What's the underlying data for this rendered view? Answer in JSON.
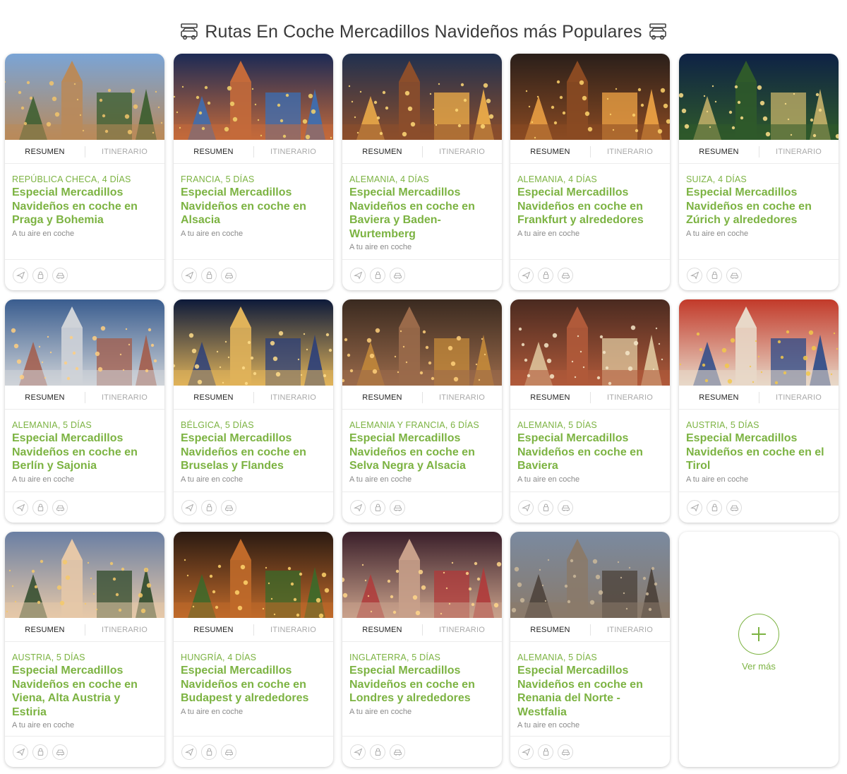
{
  "header": {
    "title": "Rutas En Coche Mercadillos Navideños más Populares"
  },
  "tabs": {
    "summary": "RESUMEN",
    "itinerary": "ITINERARIO"
  },
  "colors": {
    "accent": "#7cb342",
    "muted": "#8a8a8a"
  },
  "footer_icons": [
    "plane-icon",
    "lock-icon",
    "car-icon"
  ],
  "cards": [
    {
      "meta": "REPÚBLICA CHECA, 4 DÍAS",
      "title": "Especial Mercadillos Navideños en coche en Praga y Bohemia",
      "subtitle": "A tu aire en coche"
    },
    {
      "meta": "FRANCIA, 5 DÍAS",
      "title": "Especial Mercadillos Navideños en coche en Alsacia",
      "subtitle": "A tu aire en coche"
    },
    {
      "meta": "ALEMANIA, 4 DÍAS",
      "title": "Especial Mercadillos Navideños en coche en Baviera y Baden-Wurtemberg",
      "subtitle": "A tu aire en coche"
    },
    {
      "meta": "ALEMANIA, 4 DÍAS",
      "title": "Especial Mercadillos Navideños en coche en Frankfurt y alrededores",
      "subtitle": "A tu aire en coche"
    },
    {
      "meta": "SUIZA, 4 DÍAS",
      "title": "Especial Mercadillos Navideños en coche en Zúrich y alrededores",
      "subtitle": "A tu aire en coche"
    },
    {
      "meta": "ALEMANIA, 5 DÍAS",
      "title": "Especial Mercadillos Navideños en coche en Berlín y Sajonia",
      "subtitle": "A tu aire en coche"
    },
    {
      "meta": "BÉLGICA, 5 DÍAS",
      "title": "Especial Mercadillos Navideños en coche en Bruselas y Flandes",
      "subtitle": "A tu aire en coche"
    },
    {
      "meta": "ALEMANIA Y FRANCIA, 6 DÍAS",
      "title": "Especial Mercadillos Navideños en coche en Selva Negra y Alsacia",
      "subtitle": "A tu aire en coche"
    },
    {
      "meta": "ALEMANIA, 5 DÍAS",
      "title": "Especial Mercadillos Navideños en coche en Baviera",
      "subtitle": "A tu aire en coche"
    },
    {
      "meta": "AUSTRIA, 5 DÍAS",
      "title": "Especial Mercadillos Navideños en coche en el Tirol",
      "subtitle": "A tu aire en coche"
    },
    {
      "meta": "AUSTRIA, 5 DÍAS",
      "title": "Especial Mercadillos Navideños en coche en Viena, Alta Austria y Estiria",
      "subtitle": "A tu aire en coche"
    },
    {
      "meta": "HUNGRÍA, 4 DÍAS",
      "title": "Especial Mercadillos Navideños en coche en Budapest y alrededores",
      "subtitle": "A tu aire en coche"
    },
    {
      "meta": "INGLATERRA, 5 DÍAS",
      "title": "Especial Mercadillos Navideños en coche en Londres y alrededores",
      "subtitle": "A tu aire en coche"
    },
    {
      "meta": "ALEMANIA, 5 DÍAS",
      "title": "Especial Mercadillos Navideños en coche en Renania del Norte - Westfalia",
      "subtitle": "A tu aire en coche"
    }
  ],
  "more": {
    "label": "Ver más"
  }
}
